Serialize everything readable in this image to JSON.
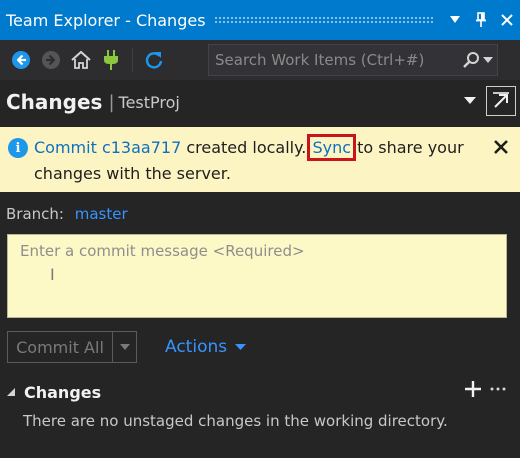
{
  "titlebar": {
    "title": "Team Explorer - Changes",
    "buttons": [
      "chevron-down-icon",
      "pin-icon",
      "close-icon"
    ]
  },
  "toolbar": {
    "buttons": [
      "back-icon",
      "forward-icon",
      "home-icon",
      "connect-icon",
      "refresh-icon"
    ],
    "search_placeholder": "Search Work Items (Ctrl+#)"
  },
  "header": {
    "title": "Changes",
    "separator": "|",
    "project": "TestProj"
  },
  "notification": {
    "commit_link": "Commit c13aa717",
    "text_mid": " created locally. ",
    "sync_link": "Sync",
    "text_end": " to share your changes with the server."
  },
  "branch": {
    "label": "Branch:",
    "value": "master"
  },
  "commit_message": {
    "placeholder": "Enter a commit message <Required>",
    "value": ""
  },
  "commit_row": {
    "commit_label": "Commit All",
    "actions_label": "Actions"
  },
  "changes_section": {
    "label": "Changes",
    "empty_message": "There are no unstaged changes in the working directory."
  },
  "colors": {
    "accent": "#007acc",
    "link": "#3794ff",
    "notification_bg": "#fcf4c2",
    "highlight_box": "#c8141b"
  }
}
